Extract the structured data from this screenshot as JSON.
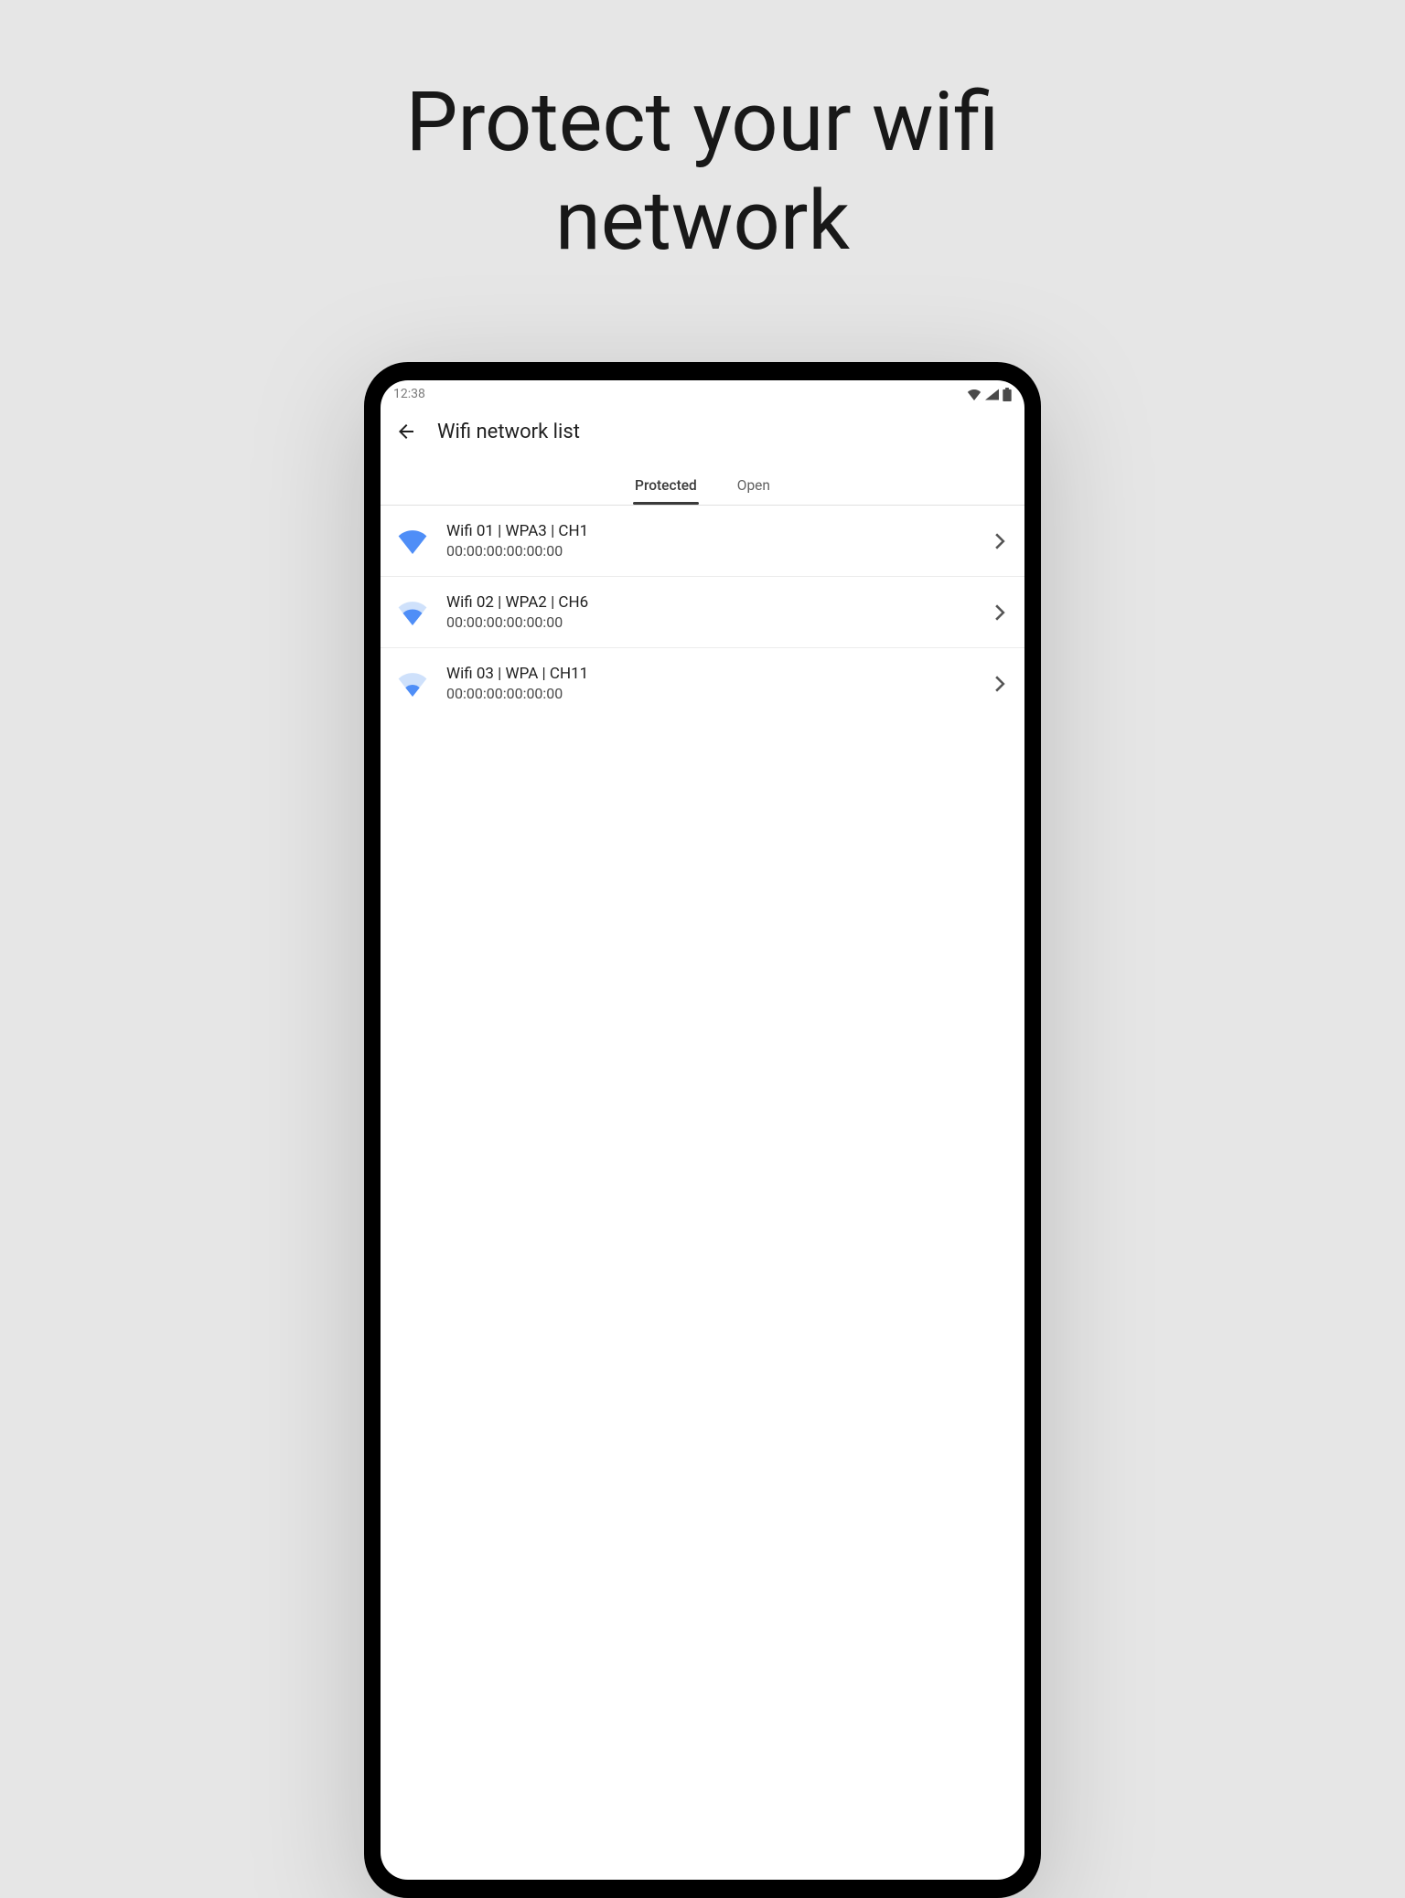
{
  "headline": "Protect your wifi\nnetwork",
  "status": {
    "time": "12:38"
  },
  "appbar": {
    "title": "Wifi network list"
  },
  "tabs": {
    "protected": "Protected",
    "open": "Open",
    "active": "protected"
  },
  "networks": [
    {
      "title": "Wifi 01 | WPA3 | CH1",
      "mac": "00:00:00:00:00:00",
      "signal": "full"
    },
    {
      "title": "Wifi 02 | WPA2 | CH6",
      "mac": "00:00:00:00:00:00",
      "signal": "medium"
    },
    {
      "title": "Wifi 03 | WPA | CH11",
      "mac": "00:00:00:00:00:00",
      "signal": "low"
    }
  ],
  "colors": {
    "wifi": "#4F8EF7",
    "wifi_bg": "#cfe1fb"
  }
}
